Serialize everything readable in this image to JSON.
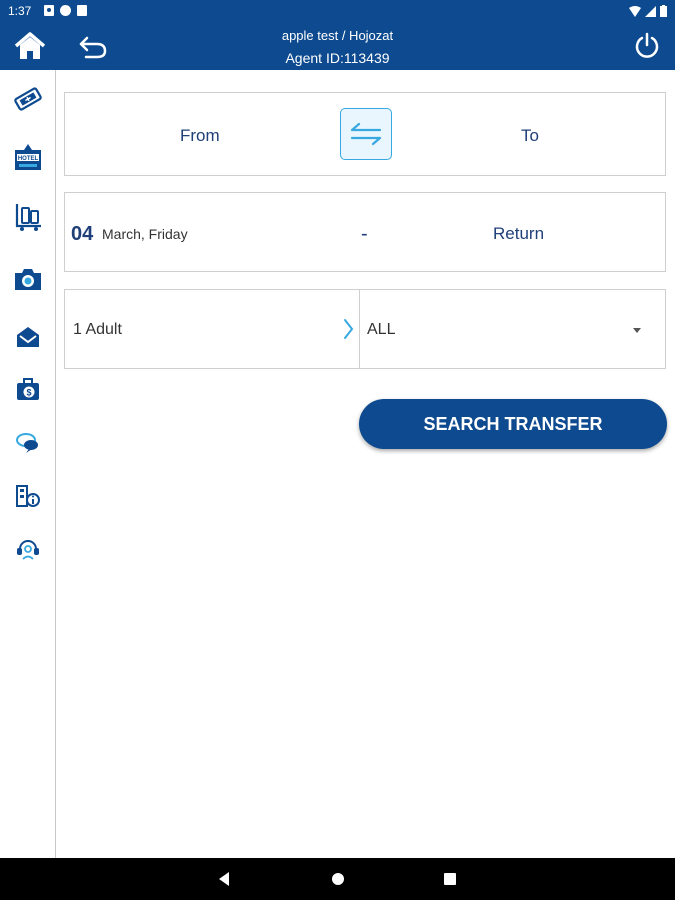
{
  "status_bar": {
    "time": "1:37"
  },
  "header": {
    "user": "apple test / Hojozat",
    "agent_id": "Agent ID:113439"
  },
  "sidebar": {
    "items": [
      "flight-ticket-icon",
      "hotel-icon",
      "luggage-cart-icon",
      "camera-icon",
      "envelope-icon",
      "suitcase-dollar-icon",
      "chat-bubbles-icon",
      "building-info-icon",
      "support-headset-icon"
    ]
  },
  "route": {
    "from_label": "From",
    "to_label": "To"
  },
  "dates": {
    "day": "04",
    "month_day": "March, Friday",
    "separator": "-",
    "return_label": "Return"
  },
  "passengers": {
    "adults": "1 Adult",
    "type_selected": "ALL"
  },
  "search_button": "SEARCH TRANSFER",
  "colors": {
    "primary": "#0d4a8f",
    "accent": "#38a9e0",
    "text_blue": "#1f3f78"
  }
}
